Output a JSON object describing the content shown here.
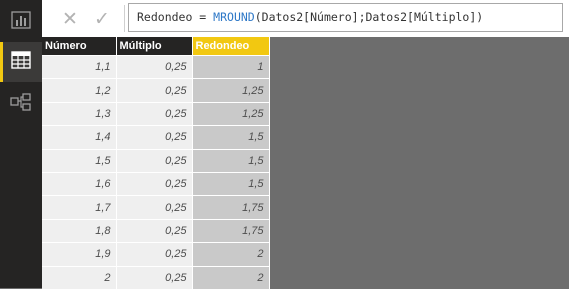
{
  "view_rail": [
    {
      "name": "report-view",
      "icon": "bar-chart-icon"
    },
    {
      "name": "data-view",
      "icon": "table-icon",
      "active": true
    },
    {
      "name": "model-view",
      "icon": "relationships-icon"
    }
  ],
  "formula_bar": {
    "cancel_glyph": "✕",
    "commit_glyph": "✓",
    "prefix": "Redondeo = ",
    "function": "MROUND",
    "args": "(Datos2[Número];Datos2[Múltiplo])"
  },
  "table": {
    "columns": [
      "Número",
      "Múltiplo",
      "Redondeo"
    ],
    "selected_column": "Redondeo",
    "rows": [
      [
        "1,1",
        "0,25",
        "1"
      ],
      [
        "1,2",
        "0,25",
        "1,25"
      ],
      [
        "1,3",
        "0,25",
        "1,25"
      ],
      [
        "1,4",
        "0,25",
        "1,5"
      ],
      [
        "1,5",
        "0,25",
        "1,5"
      ],
      [
        "1,6",
        "0,25",
        "1,5"
      ],
      [
        "1,7",
        "0,25",
        "1,75"
      ],
      [
        "1,8",
        "0,25",
        "1,75"
      ],
      [
        "1,9",
        "0,25",
        "2"
      ],
      [
        "2",
        "0,25",
        "2"
      ]
    ]
  },
  "colors": {
    "accent": "#f2c811",
    "rail_bg": "#252423",
    "canvas_bg": "#6d6d6d",
    "function_blue": "#2e78c7"
  }
}
